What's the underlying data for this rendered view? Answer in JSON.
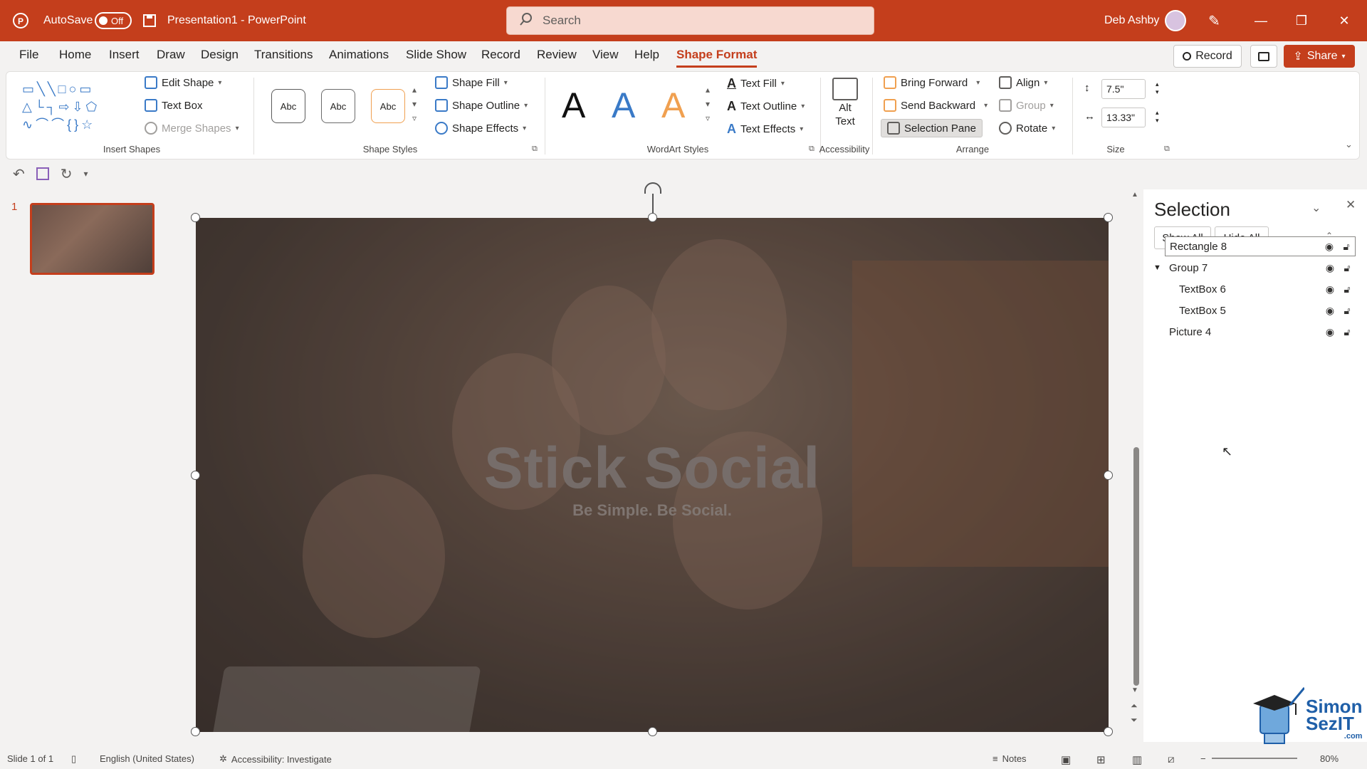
{
  "titlebar": {
    "autosave_label": "AutoSave",
    "autosave_state": "Off",
    "doc_title": "Presentation1  -  PowerPoint",
    "search_placeholder": "Search",
    "user_name": "Deb Ashby"
  },
  "menu": {
    "tabs": [
      "File",
      "Home",
      "Insert",
      "Draw",
      "Design",
      "Transitions",
      "Animations",
      "Slide Show",
      "Record",
      "Review",
      "View",
      "Help",
      "Shape Format"
    ],
    "active_tab": "Shape Format",
    "record_button": "Record",
    "share_button": "Share"
  },
  "ribbon": {
    "insert_shapes": {
      "edit_shape": "Edit Shape",
      "text_box": "Text Box",
      "merge_shapes": "Merge Shapes",
      "label": "Insert Shapes"
    },
    "shape_styles": {
      "presets": [
        "Abc",
        "Abc",
        "Abc"
      ],
      "shape_fill": "Shape Fill",
      "shape_outline": "Shape Outline",
      "shape_effects": "Shape Effects",
      "label": "Shape Styles"
    },
    "wordart": {
      "letters": [
        "A",
        "A",
        "A"
      ],
      "text_fill": "Text Fill",
      "text_outline": "Text Outline",
      "text_effects": "Text Effects",
      "label": "WordArt Styles"
    },
    "accessibility": {
      "alt_text_line1": "Alt",
      "alt_text_line2": "Text",
      "label": "Accessibility"
    },
    "arrange": {
      "bring_forward": "Bring Forward",
      "send_backward": "Send Backward",
      "selection_pane": "Selection Pane",
      "align": "Align",
      "group": "Group",
      "rotate": "Rotate",
      "label": "Arrange"
    },
    "size": {
      "height": "7.5\"",
      "width": "13.33\"",
      "label": "Size"
    }
  },
  "thumbnails": {
    "slide_number": "1"
  },
  "slide": {
    "title": "Stick Social",
    "subtitle": "Be Simple. Be Social."
  },
  "selection_pane": {
    "title": "Selection",
    "show_all": "Show All",
    "hide_all": "Hide All",
    "items": [
      {
        "name": "Rectangle 8",
        "selected": true
      },
      {
        "name": "Group 7",
        "group": true
      },
      {
        "name": "TextBox 6",
        "child": true
      },
      {
        "name": "TextBox 5",
        "child": true
      },
      {
        "name": "Picture 4"
      }
    ]
  },
  "statusbar": {
    "slide_count": "Slide 1 of 1",
    "language": "English (United States)",
    "accessibility": "Accessibility: Investigate",
    "notes": "Notes",
    "zoom": "80%"
  },
  "watermark": {
    "line1": "Simon",
    "line2": "SezIT",
    "suffix": ".com"
  },
  "colors": {
    "accent": "#c43e1c",
    "wordart_blue": "#3a7ac7",
    "wordart_orange": "#f0a050"
  }
}
